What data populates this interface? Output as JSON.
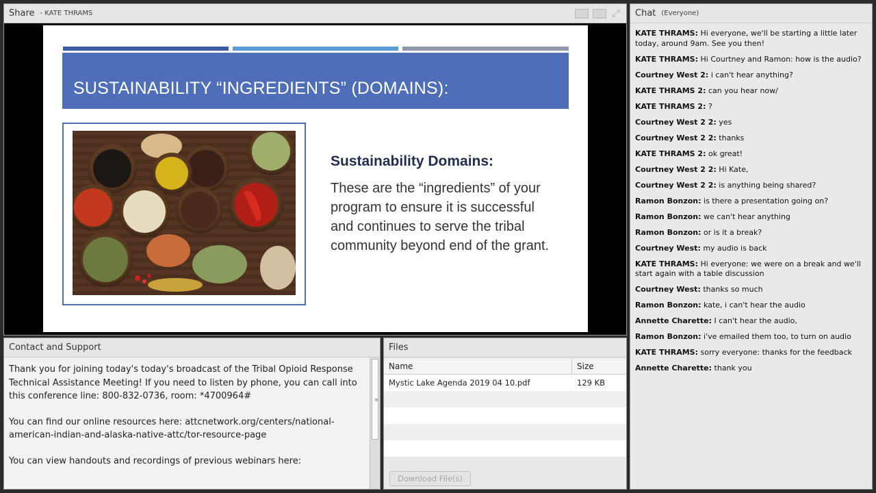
{
  "share": {
    "title": "Share",
    "presenter": "- KATE THRAMS",
    "slide": {
      "title": "SUSTAINABILITY “INGREDIENTS” (DOMAINS):",
      "heading": "Sustainability Domains:",
      "body": "These are the “ingredients” of your program to ensure it is successful and continues to serve the tribal community beyond end of the grant."
    }
  },
  "contact": {
    "title": "Contact and Support",
    "paragraphs": [
      "Thank you for joining today's today's broadcast of the Tribal Opioid Response Technical Assistance Meeting!  If you need to listen by phone, you can call into this conference line: 800-832-0736, room: *4700964#",
      "You can find our online resources here: attcnetwork.org/centers/national-american-indian-and-alaska-native-attc/tor-resource-page",
      "You can view handouts and recordings of previous webinars here:"
    ]
  },
  "files": {
    "title": "Files",
    "columns": {
      "name": "Name",
      "size": "Size"
    },
    "rows": [
      {
        "name": "Mystic Lake Agenda 2019 04 10.pdf",
        "size": "129 KB"
      }
    ],
    "download_label": "Download File(s)"
  },
  "chat": {
    "title": "Chat",
    "audience": "(Everyone)",
    "messages": [
      {
        "sender": "KATE THRAMS:",
        "text": " Hi everyone, we'll be starting a little later today, around 9am.  See you then!"
      },
      {
        "sender": "KATE THRAMS:",
        "text": " Hi Courtney and Ramon: how is the audio?"
      },
      {
        "sender": "Courtney West 2:",
        "text": " i can't hear anything?"
      },
      {
        "sender": "KATE THRAMS 2:",
        "text": " can you hear now/"
      },
      {
        "sender": "KATE THRAMS 2:",
        "text": " ?"
      },
      {
        "sender": "Courtney West 2 2:",
        "text": " yes"
      },
      {
        "sender": "Courtney West 2 2:",
        "text": " thanks"
      },
      {
        "sender": "KATE THRAMS 2:",
        "text": " ok great!"
      },
      {
        "sender": "Courtney West 2 2:",
        "text": " Hi Kate,"
      },
      {
        "sender": "Courtney West 2 2:",
        "text": " is anything being shared?"
      },
      {
        "sender": "Ramon Bonzon:",
        "text": " is there a presentation going on?"
      },
      {
        "sender": "Ramon Bonzon:",
        "text": " we can't hear anything"
      },
      {
        "sender": "Ramon Bonzon:",
        "text": " or is it a break?"
      },
      {
        "sender": "Courtney West:",
        "text": " my audio is back"
      },
      {
        "sender": "KATE THRAMS:",
        "text": " Hi everyone: we were on a break and we'll start again with a table discussion"
      },
      {
        "sender": "Courtney West:",
        "text": " thanks so much"
      },
      {
        "sender": "Ramon Bonzon:",
        "text": " kate, i can't hear the audio"
      },
      {
        "sender": "Annette Charette:",
        "text": " I can't hear the audio,"
      },
      {
        "sender": "Ramon Bonzon:",
        "text": " i've emailed them too, to turn on audio"
      },
      {
        "sender": "KATE THRAMS:",
        "text": " sorry everyone: thanks for the feedback"
      },
      {
        "sender": "Annette Charette:",
        "text": " thank you"
      }
    ]
  }
}
